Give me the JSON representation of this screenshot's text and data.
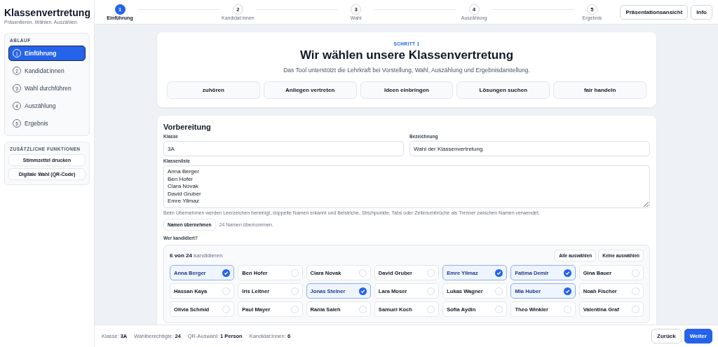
{
  "app": {
    "title": "Klassenvertretung",
    "subtitle": "Präsentieren. Wählen. Auszählen."
  },
  "sidebar": {
    "flow_title": "ABLAUF",
    "items": [
      {
        "number": "1",
        "label": "Einführung",
        "selected": true
      },
      {
        "number": "2",
        "label": "Kandidat:innen",
        "selected": false
      },
      {
        "number": "3",
        "label": "Wahl durchführen",
        "selected": false
      },
      {
        "number": "4",
        "label": "Auszählung",
        "selected": false
      },
      {
        "number": "5",
        "label": "Ergebnis",
        "selected": false
      }
    ],
    "extra_title": "ZUSÄTZLICHE FUNKTIONEN",
    "extra_buttons": [
      "Stimmzettel drucken",
      "Digitale Wahl (QR-Code)"
    ]
  },
  "stepper": [
    {
      "number": "1",
      "label": "Einführung",
      "selected": true
    },
    {
      "number": "2",
      "label": "Kandidat:innen",
      "selected": false
    },
    {
      "number": "3",
      "label": "Wahl",
      "selected": false
    },
    {
      "number": "4",
      "label": "Auszählung",
      "selected": false
    },
    {
      "number": "5",
      "label": "Ergebnis",
      "selected": false
    }
  ],
  "top_buttons": [
    "Präsentationsansicht",
    "Info"
  ],
  "intro": {
    "eyebrow": "SCHRITT 1",
    "heading": "Wir wählen unsere Klassenvertretung",
    "text": "Das Tool unterstützt die Lehrkraft bei Vorstellung, Wahl, Auszählung und Ergebnisdarstellung.",
    "values": [
      "zuhören",
      "Anliegen vertreten",
      "Ideen einbringen",
      "Lösungen suchen",
      "fair handeln"
    ]
  },
  "preparation": {
    "heading": "Vorbereitung",
    "class_label": "Klasse",
    "class_value": "3A",
    "name_label": "Bezeichnung",
    "name_value": "Wahl der Klassenvertretung",
    "list_label": "Klassenliste",
    "list_value": "Anna Berger\nBen Hofer\nClara Novak\nDavid Gruber\nEmre Yilmaz",
    "hint": "Beim Übernehmen werden Leerzeichen bereinigt, doppelte Namen erkannt und Beistriche, Strichpunkte, Tabs oder Zeilenumbrüche als Trenner zwischen Namen verwendet.",
    "apply_button": "Namen übernehmen",
    "apply_status": "24 Namen übernommen.",
    "candidates_label": "Wer kandidiert?"
  },
  "candidates": {
    "count": "**6 von 24** kandidieren",
    "select_all": "Alle auswählen",
    "select_none": "Keine auswählen",
    "items": [
      {
        "name": "Anna Berger",
        "selected": true
      },
      {
        "name": "Ben Hofer",
        "selected": false
      },
      {
        "name": "Clara Novak",
        "selected": false
      },
      {
        "name": "David Gruber",
        "selected": false
      },
      {
        "name": "Emre Yilmaz",
        "selected": true
      },
      {
        "name": "Fatima Demir",
        "selected": true
      },
      {
        "name": "Gina Bauer",
        "selected": false
      },
      {
        "name": "Hassan Kaya",
        "selected": false
      },
      {
        "name": "Iris Leitner",
        "selected": false
      },
      {
        "name": "Jonas Steiner",
        "selected": true
      },
      {
        "name": "Lara Moser",
        "selected": false
      },
      {
        "name": "Lukas Wagner",
        "selected": false
      },
      {
        "name": "Mia Huber",
        "selected": true
      },
      {
        "name": "Noah Fischer",
        "selected": false
      },
      {
        "name": "Olivia Schmid",
        "selected": false
      },
      {
        "name": "Paul Mayer",
        "selected": false
      },
      {
        "name": "Rania Saleh",
        "selected": false
      },
      {
        "name": "Samuel Koch",
        "selected": false
      },
      {
        "name": "Sofia Aydin",
        "selected": false
      },
      {
        "name": "Theo Winkler",
        "selected": false
      },
      {
        "name": "Valentina Graf",
        "selected": false
      }
    ]
  },
  "status_bar": {
    "items": [
      {
        "label": "Klasse:",
        "value": "3A"
      },
      {
        "label": "Wahlberechtigte:",
        "value": "24"
      },
      {
        "label": "QR-Auswahl:",
        "value": "1 Person"
      },
      {
        "label": "Kandidat:innen:",
        "value": "6"
      }
    ],
    "back_button": "Zurück",
    "next_button": "Weiter"
  }
}
